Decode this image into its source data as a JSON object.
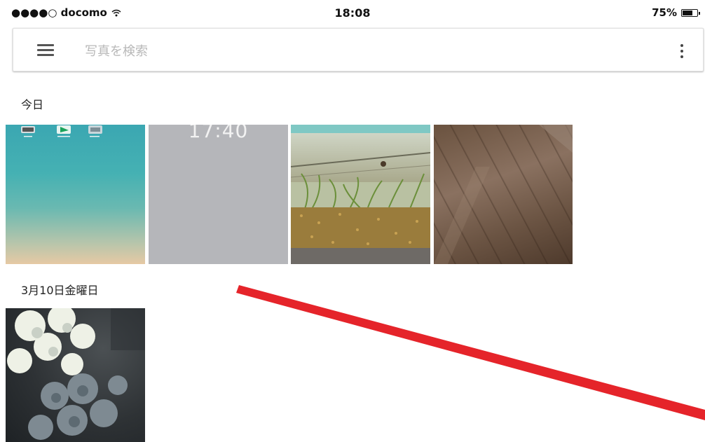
{
  "status_bar": {
    "carrier": "●●●●○ docomo",
    "time": "18:08",
    "battery_percent": "75%",
    "battery_level": 0.75
  },
  "search": {
    "placeholder": "写真を検索",
    "value": ""
  },
  "sections": [
    {
      "header": "今日",
      "photos": [
        {
          "kind": "home-screen",
          "icon": "tablet-home-screen-thumbnail"
        },
        {
          "kind": "lock-screen",
          "icon": "lock-screen-thumbnail",
          "time": "17:40"
        },
        {
          "kind": "aquarium",
          "icon": "aquarium-photo-thumbnail"
        },
        {
          "kind": "wood-floor",
          "icon": "wood-floor-photo-thumbnail"
        }
      ]
    },
    {
      "header": "3月10日金曜日",
      "photos": [
        {
          "kind": "flowers",
          "icon": "flower-photo-thumbnail"
        }
      ]
    }
  ],
  "colors": {
    "annotation_red": "#e5242a",
    "text": "#222222",
    "placeholder": "#b8b8b8"
  }
}
